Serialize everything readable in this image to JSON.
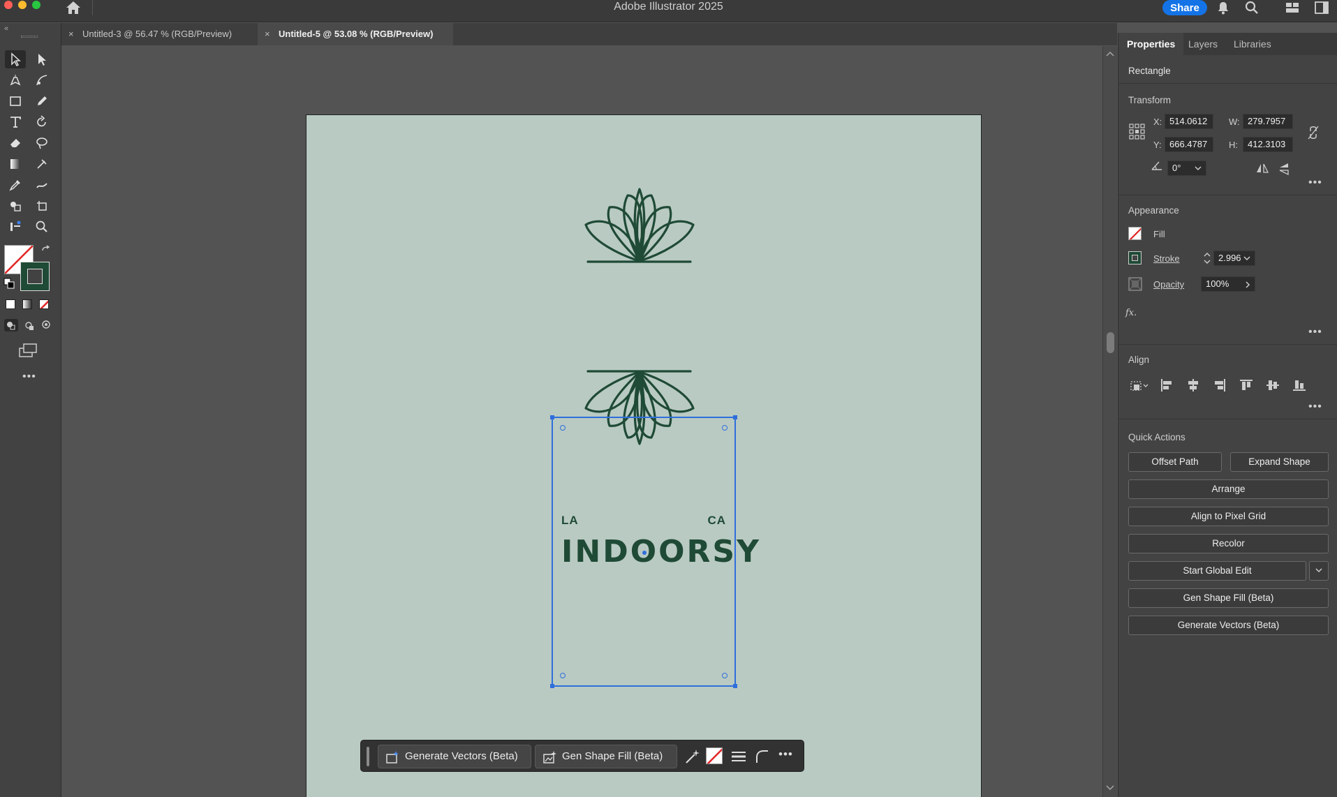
{
  "app": {
    "title": "Adobe Illustrator 2025",
    "share_label": "Share"
  },
  "tabs": [
    {
      "label": "Untitled-3 @ 56.47 % (RGB/Preview)",
      "close": "×"
    },
    {
      "label": "Untitled-5 @ 53.08 % (RGB/Preview)",
      "close": "×"
    }
  ],
  "artwork": {
    "left_word": "LA",
    "right_word": "CA",
    "brand": "INDOORSY",
    "ink_color": "#1f4a36",
    "artboard_color": "#b9cac3",
    "selection_color": "#2f6fdb"
  },
  "taskbar": {
    "generate_vectors": "Generate Vectors (Beta)",
    "gen_shape_fill": "Gen Shape Fill (Beta)",
    "more": "•••"
  },
  "panel": {
    "tabs": [
      "Properties",
      "Layers",
      "Libraries"
    ],
    "object_type": "Rectangle",
    "transform": {
      "title": "Transform",
      "x_label": "X:",
      "x": "514.0612",
      "y_label": "Y:",
      "y": "666.4787",
      "w_label": "W:",
      "w": "279.7957",
      "h_label": "H:",
      "h": "412.3103",
      "angle": "0°"
    },
    "appearance": {
      "title": "Appearance",
      "fill_label": "Fill",
      "stroke_label": "Stroke",
      "stroke_value": "2.996",
      "opacity_label": "Opacity",
      "opacity_value": "100%",
      "fx_label": "fx."
    },
    "align": {
      "title": "Align"
    },
    "quick_actions": {
      "title": "Quick Actions",
      "offset_path": "Offset Path",
      "expand_shape": "Expand Shape",
      "arrange": "Arrange",
      "align_pixel_grid": "Align to Pixel Grid",
      "recolor": "Recolor",
      "start_global_edit": "Start Global Edit",
      "gen_shape_fill": "Gen Shape Fill (Beta)",
      "generate_vectors": "Generate Vectors (Beta)"
    },
    "more": "•••"
  },
  "toolbar": {
    "more": "•••"
  }
}
